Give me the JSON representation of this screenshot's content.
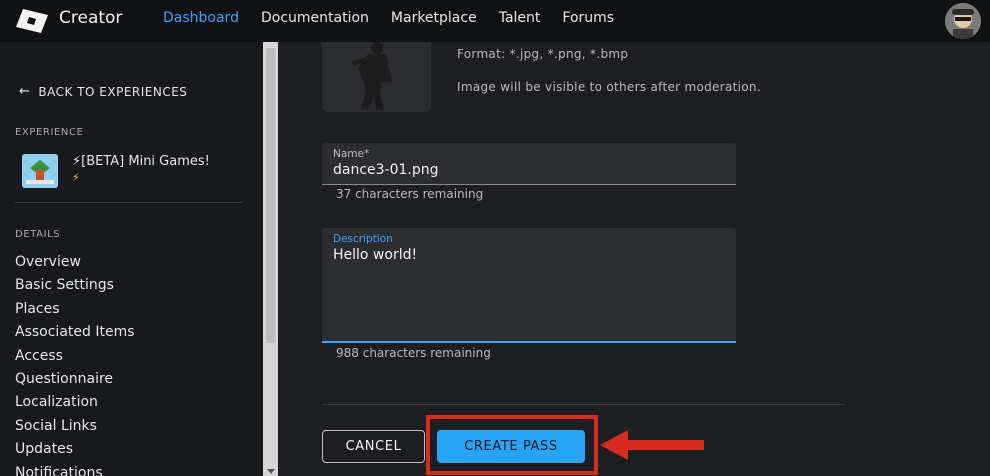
{
  "topbar": {
    "brand": "Creator",
    "nav": [
      "Dashboard",
      "Documentation",
      "Marketplace",
      "Talent",
      "Forums"
    ],
    "active_nav": "Dashboard"
  },
  "sidebar": {
    "back_label": "BACK TO EXPERIENCES",
    "experience_section": "EXPERIENCE",
    "experience_name": "⚡[BETA] Mini Games!",
    "experience_bolt": "⚡",
    "details_section": "DETAILS",
    "menu": [
      "Overview",
      "Basic Settings",
      "Places",
      "Associated Items",
      "Access",
      "Questionnaire",
      "Localization",
      "Social Links",
      "Updates",
      "Notifications"
    ]
  },
  "main": {
    "format_hint": "Format: *.jpg, *.png, *.bmp",
    "moderation_hint": "Image will be visible to others after moderation.",
    "name_field": {
      "label": "Name*",
      "value": "dance3-01.png",
      "counter": "37 characters remaining"
    },
    "description_field": {
      "label": "Description",
      "value": "Hello world!",
      "counter": "988 characters remaining"
    },
    "cancel_label": "CANCEL",
    "create_label": "CREATE PASS"
  },
  "colors": {
    "accent": "#3aa2ff",
    "create_button": "#28a4f4",
    "annotation_red": "#d62b1f",
    "background": "#1d1e21",
    "topbar": "#101113"
  }
}
